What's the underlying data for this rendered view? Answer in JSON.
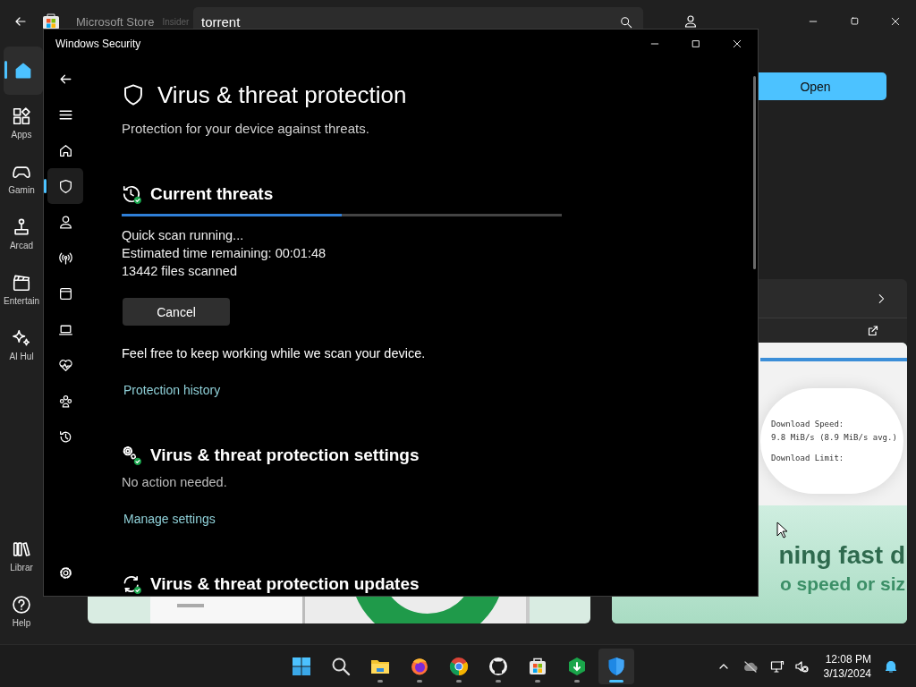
{
  "store": {
    "title": "Microsoft Store",
    "badge": "Insider",
    "search": {
      "value": "torrent"
    },
    "nav": [
      {
        "kind": "home",
        "selected": true
      },
      {
        "kind": "apps",
        "label": "Apps",
        "selected": false
      },
      {
        "kind": "gaming",
        "label": "Gamin",
        "selected": false
      },
      {
        "kind": "arcade",
        "label": "Arcad",
        "selected": false
      },
      {
        "kind": "entertainment",
        "label": "Entertain",
        "selected": false
      },
      {
        "kind": "aihub",
        "label": "AI Hul",
        "selected": false
      },
      {
        "kind": "library",
        "label": "Librar",
        "selected": false
      },
      {
        "kind": "help",
        "label": "Help",
        "selected": false
      }
    ],
    "open_button": "Open",
    "gallery": [
      {
        "kind": "picture"
      },
      {
        "kind": "screenshot",
        "lines": [
          "Download Speed:",
          "9.8 MiB/s (8.9 MiB/s avg.)",
          "Download Limit:"
        ],
        "headline": "ning fast d",
        "subline": "o speed or siz"
      }
    ]
  },
  "security": {
    "title": "Windows Security",
    "nav": [
      {
        "kind": "back",
        "selected": false
      },
      {
        "kind": "menu",
        "selected": false
      },
      {
        "kind": "home",
        "selected": false
      },
      {
        "kind": "shield",
        "selected": true
      },
      {
        "kind": "account",
        "selected": false
      },
      {
        "kind": "network",
        "selected": false
      },
      {
        "kind": "app",
        "selected": false
      },
      {
        "kind": "device",
        "selected": false
      },
      {
        "kind": "health",
        "selected": false
      },
      {
        "kind": "family",
        "selected": false
      },
      {
        "kind": "history",
        "selected": false
      },
      {
        "kind": "settings",
        "selected": false
      }
    ],
    "heading": "Virus & threat protection",
    "subtitle": "Protection for your device against threats.",
    "sections": [
      {
        "kind": "scan",
        "title": "Current threats",
        "progress": {
          "level": 0.5
        },
        "status": [
          "Quick scan running...",
          "Estimated time remaining: 00:01:48",
          "13442 files scanned"
        ],
        "button": "Cancel",
        "note": "Feel free to keep working while we scan your device.",
        "link": "Protection history"
      },
      {
        "kind": "settings",
        "title": "Virus & threat protection settings",
        "status": [
          "No action needed."
        ],
        "link": "Manage settings"
      },
      {
        "kind": "updates",
        "title": "Virus & threat protection updates"
      }
    ]
  },
  "taskbar": {
    "apps": [
      {
        "kind": "start",
        "running": false,
        "selected": false
      },
      {
        "kind": "search",
        "running": false,
        "selected": false
      },
      {
        "kind": "files",
        "running": true,
        "selected": false
      },
      {
        "kind": "firefox",
        "running": true,
        "selected": false
      },
      {
        "kind": "chrome",
        "running": true,
        "selected": false
      },
      {
        "kind": "github",
        "running": true,
        "selected": false
      },
      {
        "kind": "store",
        "running": true,
        "selected": false
      },
      {
        "kind": "torrent",
        "running": true,
        "selected": false
      },
      {
        "kind": "security",
        "running": true,
        "selected": true
      }
    ],
    "time": "12:08 PM",
    "date": "3/13/2024"
  }
}
